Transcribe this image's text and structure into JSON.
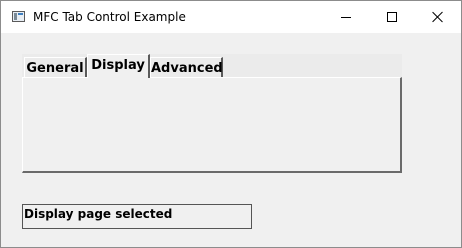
{
  "window": {
    "title": "MFC Tab Control Example",
    "icon": "application-icon",
    "controls": {
      "minimize": "minimize-icon",
      "maximize": "maximize-icon",
      "close": "close-icon"
    }
  },
  "tab_control": {
    "tabs": [
      {
        "label": "General",
        "selected": false
      },
      {
        "label": "Display",
        "selected": true
      },
      {
        "label": "Advanced",
        "selected": false
      }
    ]
  },
  "status": {
    "text": "Display page selected"
  },
  "colors": {
    "face": "#f0f0f0",
    "titlebar": "#ffffff",
    "shadow": "#6a6a6a"
  }
}
